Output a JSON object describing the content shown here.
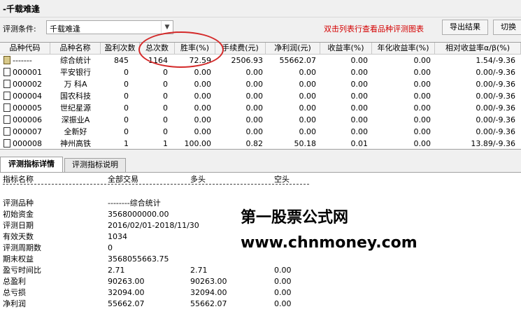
{
  "window": {
    "title": "-千载难逢"
  },
  "condition": {
    "label": "评测条件:",
    "value": "千载难逢",
    "hint": "双击列表行查看品种评测图表",
    "export_button": "导出结果",
    "switch_button": "切换"
  },
  "table": {
    "columns": [
      "品种代码",
      "品种名称",
      "盈利次数",
      "总次数",
      "胜率(%)",
      "手续费(元)",
      "净利润(元)",
      "收益率(%)",
      "年化收益率(%)",
      "相对收益率α/β(%)"
    ],
    "rows": [
      {
        "code": "-------",
        "name": "综合统计",
        "wins": "845",
        "total": "1164",
        "rate": "72.59",
        "fee": "2506.93",
        "profit": "55662.07",
        "ret": "0.00",
        "annual": "0.00",
        "rel": "1.54/-9.36"
      },
      {
        "code": "000001",
        "name": "平安银行",
        "wins": "0",
        "total": "0",
        "rate": "0.00",
        "fee": "0.00",
        "profit": "0.00",
        "ret": "0.00",
        "annual": "0.00",
        "rel": "0.00/-9.36"
      },
      {
        "code": "000002",
        "name": "万 科A",
        "wins": "0",
        "total": "0",
        "rate": "0.00",
        "fee": "0.00",
        "profit": "0.00",
        "ret": "0.00",
        "annual": "0.00",
        "rel": "0.00/-9.36"
      },
      {
        "code": "000004",
        "name": "国农科技",
        "wins": "0",
        "total": "0",
        "rate": "0.00",
        "fee": "0.00",
        "profit": "0.00",
        "ret": "0.00",
        "annual": "0.00",
        "rel": "0.00/-9.36"
      },
      {
        "code": "000005",
        "name": "世纪星源",
        "wins": "0",
        "total": "0",
        "rate": "0.00",
        "fee": "0.00",
        "profit": "0.00",
        "ret": "0.00",
        "annual": "0.00",
        "rel": "0.00/-9.36"
      },
      {
        "code": "000006",
        "name": "深振业A",
        "wins": "0",
        "total": "0",
        "rate": "0.00",
        "fee": "0.00",
        "profit": "0.00",
        "ret": "0.00",
        "annual": "0.00",
        "rel": "0.00/-9.36"
      },
      {
        "code": "000007",
        "name": "全新好",
        "wins": "0",
        "total": "0",
        "rate": "0.00",
        "fee": "0.00",
        "profit": "0.00",
        "ret": "0.00",
        "annual": "0.00",
        "rel": "0.00/-9.36"
      },
      {
        "code": "000008",
        "name": "神州高铁",
        "wins": "1",
        "total": "1",
        "rate": "100.00",
        "fee": "0.82",
        "profit": "50.18",
        "ret": "0.01",
        "annual": "0.00",
        "rel": "13.89/-9.36"
      }
    ]
  },
  "tabs": [
    {
      "label": "评测指标详情",
      "active": true
    },
    {
      "label": "评测指标说明",
      "active": false
    }
  ],
  "detail": {
    "headers": [
      "指标名称",
      "全部交易",
      "多头",
      "空头"
    ],
    "rows": [
      {
        "name": "评测品种",
        "all": "--------综合统计",
        "long": "",
        "short": ""
      },
      {
        "name": "初始资金",
        "all": "3568000000.00",
        "long": "",
        "short": ""
      },
      {
        "name": "评测日期",
        "all": "2016/02/01-2018/11/30",
        "long": "",
        "short": ""
      },
      {
        "name": "有效天数",
        "all": "1034",
        "long": "",
        "short": ""
      },
      {
        "name": "评测周期数",
        "all": "0",
        "long": "",
        "short": ""
      },
      {
        "name": "期末权益",
        "all": "3568055663.75",
        "long": "",
        "short": ""
      },
      {
        "name": "盈亏时间比",
        "all": "2.71",
        "long": "2.71",
        "short": "0.00"
      },
      {
        "name": "总盈利",
        "all": "90263.00",
        "long": "90263.00",
        "short": "0.00"
      },
      {
        "name": "总亏损",
        "all": "32094.00",
        "long": "32094.00",
        "short": "0.00"
      },
      {
        "name": "净利润",
        "all": "55662.07",
        "long": "55662.07",
        "short": "0.00"
      }
    ]
  },
  "watermark": {
    "line1": "第一股票公式网",
    "line2": "www.chnmoney.com"
  },
  "colors": {
    "hint": "#d40000",
    "highlight_circle": "#d42a2a"
  }
}
